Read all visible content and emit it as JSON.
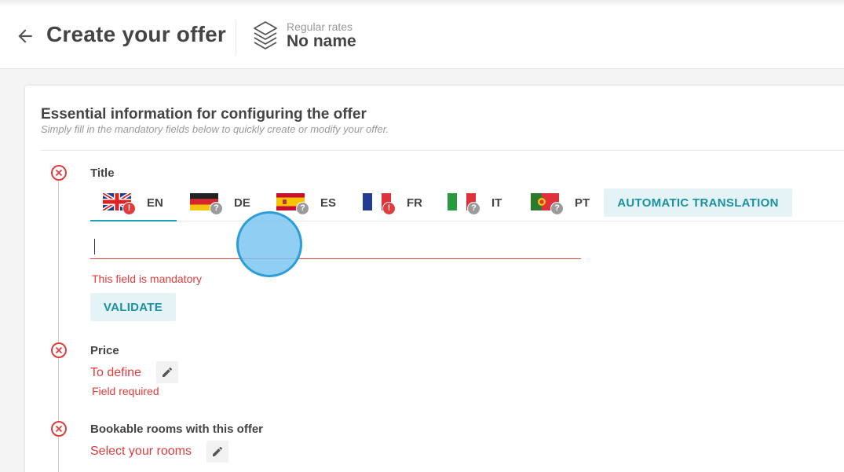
{
  "header": {
    "title": "Create your offer",
    "rate_caption": "Regular rates",
    "rate_name": "No name"
  },
  "card": {
    "title": "Essential information for configuring the offer",
    "subtitle": "Simply fill in the mandatory fields below to quickly create or modify your offer."
  },
  "steps": {
    "title": {
      "label": "Title",
      "languages": [
        {
          "code": "EN",
          "flag": "uk-flag-icon",
          "status": "error",
          "active": true
        },
        {
          "code": "DE",
          "flag": "germany-flag-icon",
          "status": "unknown",
          "active": false
        },
        {
          "code": "ES",
          "flag": "spain-flag-icon",
          "status": "unknown",
          "active": false
        },
        {
          "code": "FR",
          "flag": "france-flag-icon",
          "status": "error",
          "active": false
        },
        {
          "code": "IT",
          "flag": "italy-flag-icon",
          "status": "unknown",
          "active": false
        },
        {
          "code": "PT",
          "flag": "portugal-flag-icon",
          "status": "unknown",
          "active": false
        }
      ],
      "auto_translate_label": "AUTOMATIC TRANSLATION",
      "input_value": "",
      "error": "This field is mandatory",
      "validate_label": "VALIDATE"
    },
    "price": {
      "label": "Price",
      "link": "To define",
      "error": "Field required"
    },
    "rooms": {
      "label": "Bookable rooms with this offer",
      "link": "Select your rooms"
    }
  },
  "badges": {
    "error": "!",
    "unknown": "?"
  },
  "colors": {
    "accent": "#1da1b7",
    "error": "#e03c3c",
    "button_bg": "#e4f4f6"
  }
}
